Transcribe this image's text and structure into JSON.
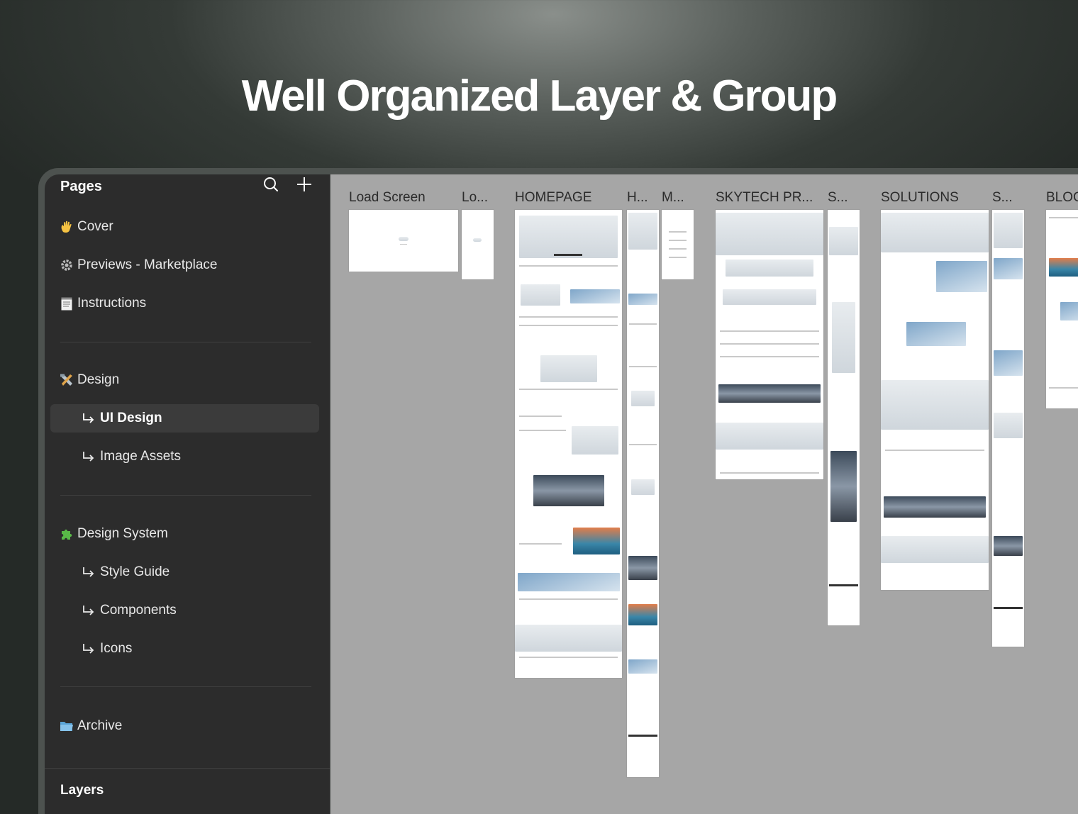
{
  "headline": "Well Organized Layer & Group",
  "panel": {
    "title": "Pages",
    "layers_title": "Layers",
    "pages": [
      {
        "icon": "waving-hand-icon",
        "label": "Cover"
      },
      {
        "icon": "gear-icon",
        "label": "Previews - Marketplace"
      },
      {
        "icon": "notepad-icon",
        "label": "Instructions"
      },
      {
        "icon": "tools-icon",
        "label": "Design"
      },
      {
        "icon": "puzzle-piece-icon",
        "label": "Design System"
      },
      {
        "icon": "folder-icon",
        "label": "Archive"
      }
    ],
    "design_subpages": [
      "UI Design",
      "Image Assets"
    ],
    "design_system_subpages": [
      "Style Guide",
      "Components",
      "Icons"
    ],
    "active_page": "UI Design"
  },
  "canvas": {
    "frames": [
      {
        "label": "Load Screen"
      },
      {
        "label": "Lo..."
      },
      {
        "label": "HOMEPAGE"
      },
      {
        "label": "H..."
      },
      {
        "label": "M..."
      },
      {
        "label": "SKYTECH PR..."
      },
      {
        "label": "S..."
      },
      {
        "label": "SOLUTIONS"
      },
      {
        "label": "S..."
      },
      {
        "label": "BLOG"
      }
    ]
  },
  "colors": {
    "panel_bg": "#2c2c2c",
    "canvas_bg": "#a6a6a6",
    "active_item_bg": "#3b3b3b"
  }
}
